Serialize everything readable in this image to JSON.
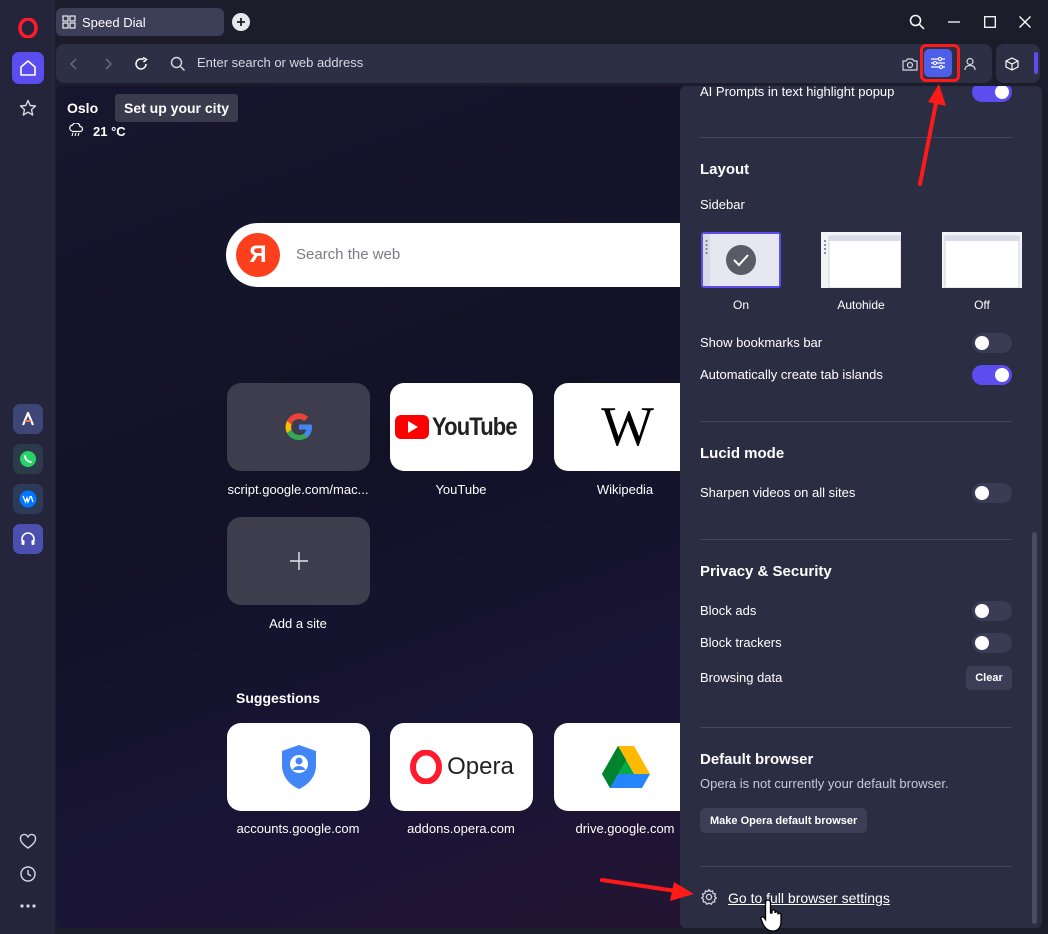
{
  "tabs": [
    {
      "label": "Speed Dial"
    }
  ],
  "address_bar": {
    "placeholder": "Enter search or web address"
  },
  "weather": {
    "city": "Oslo",
    "tooltip": "Set up your city",
    "temperature": "21 °C"
  },
  "search": {
    "placeholder": "Search the web",
    "engine_letter": "Я"
  },
  "speed_dial": [
    {
      "label": "script.google.com/mac...",
      "icon": "google-icon"
    },
    {
      "label": "YouTube",
      "icon": "youtube-logo"
    },
    {
      "label": "Wikipedia",
      "icon": "wikipedia-logo"
    },
    {
      "label": "Add a site",
      "icon": "plus-icon"
    }
  ],
  "youtube_wordmark": "YouTube",
  "wikipedia_letter": "W",
  "suggestions": {
    "title": "Suggestions",
    "items": [
      {
        "label": "accounts.google.com",
        "icon": "google-account-icon"
      },
      {
        "label": "addons.opera.com",
        "icon": "opera-logo"
      },
      {
        "label": "drive.google.com",
        "icon": "google-drive-icon"
      }
    ],
    "opera_wordmark": "Opera"
  },
  "settings": {
    "ai_prompts": {
      "label": "AI Prompts in text highlight popup",
      "on": true
    },
    "layout": {
      "title": "Layout",
      "sidebar_label": "Sidebar",
      "options": [
        {
          "label": "On",
          "selected": true
        },
        {
          "label": "Autohide",
          "selected": false
        },
        {
          "label": "Off",
          "selected": false
        }
      ],
      "show_bookmarks_bar": {
        "label": "Show bookmarks bar",
        "on": false
      },
      "tab_islands": {
        "label": "Automatically create tab islands",
        "on": true
      }
    },
    "lucid": {
      "title": "Lucid mode",
      "sharpen": {
        "label": "Sharpen videos on all sites",
        "on": false
      }
    },
    "privacy": {
      "title": "Privacy & Security",
      "block_ads": {
        "label": "Block ads",
        "on": false
      },
      "block_trackers": {
        "label": "Block trackers",
        "on": false
      },
      "browsing_data": {
        "label": "Browsing data",
        "button": "Clear"
      }
    },
    "default_browser": {
      "title": "Default browser",
      "status": "Opera is not currently your default browser.",
      "button": "Make Opera default browser"
    },
    "full_settings_link": "Go to full browser settings"
  },
  "colors": {
    "accent": "#5b4df0",
    "annotation": "#ff1a1a"
  }
}
